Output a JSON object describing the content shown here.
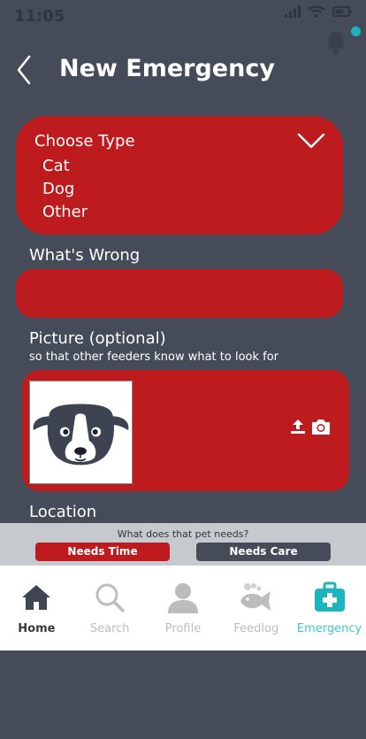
{
  "status": {
    "time": "11:05"
  },
  "colors": {
    "background": "#454b59",
    "card_red": "#be1b1f",
    "accent_teal": "#1ab5bd",
    "panel_gray": "#c6cacf",
    "tab_inactive": "#bcbcbc"
  },
  "header": {
    "title": "New Emergency",
    "back_icon": "chevron-left-icon",
    "bell_icon": "bell-icon"
  },
  "type_select": {
    "header": "Choose Type",
    "options": [
      "Cat",
      "Dog",
      "Other"
    ],
    "chevron_icon": "chevron-down-icon"
  },
  "whats_wrong": {
    "label": "What's Wrong",
    "value": ""
  },
  "picture": {
    "label": "Picture (optional)",
    "sublabel": "so that other feeders know what to look for",
    "upload_icon": "upload-icon",
    "camera_icon": "camera-icon"
  },
  "location": {
    "label": "Location"
  },
  "needs": {
    "question": "What does that pet needs?",
    "time_label": "Needs Time",
    "care_label": "Needs Care"
  },
  "tabs": [
    {
      "label": "Home",
      "icon": "home-icon"
    },
    {
      "label": "Search",
      "icon": "search-icon"
    },
    {
      "label": "Profile",
      "icon": "profile-icon"
    },
    {
      "label": "Feedlog",
      "icon": "fish-icon"
    },
    {
      "label": "Emergency",
      "icon": "first-aid-icon"
    }
  ]
}
